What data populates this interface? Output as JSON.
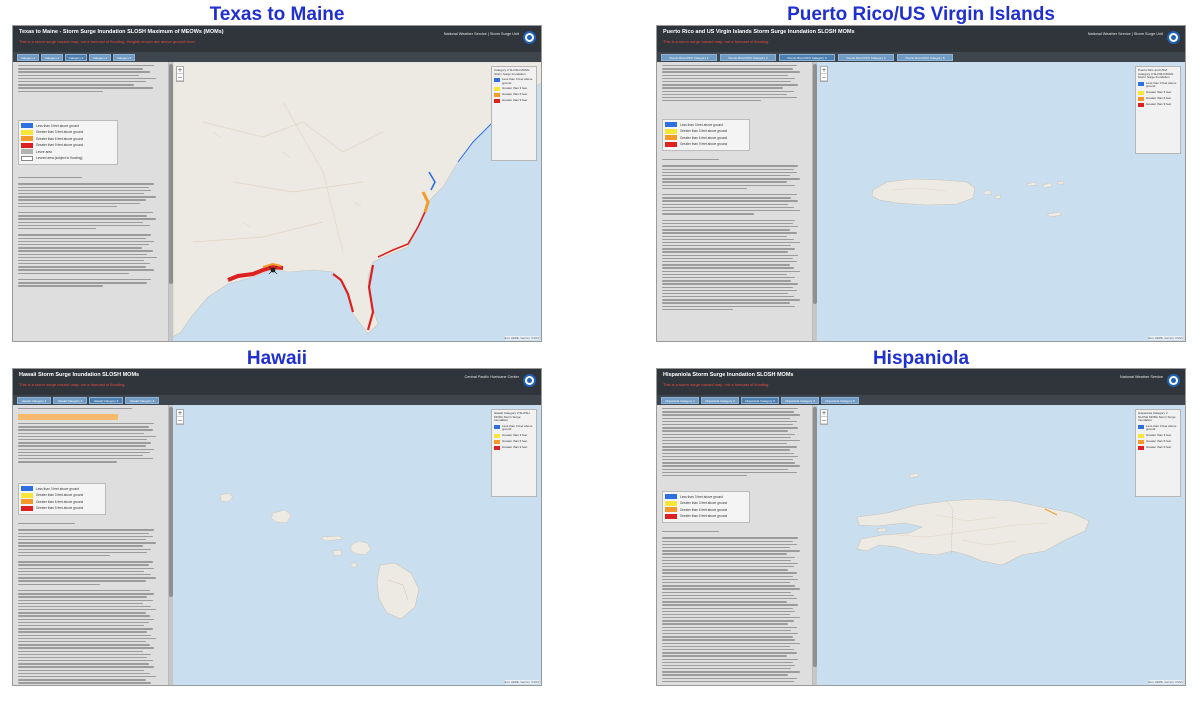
{
  "panels": [
    {
      "title": "Texas to Maine",
      "window_title": "Texas to Maine - Storm Surge Inundation SLOSH Maximum of MEOWs (MOMs)",
      "subtitle": "This is a storm surge hazard map; not a forecast of flooding. Heights shown are above ground level.",
      "org": "National Weather Service | Storm Surge Unit",
      "tabs": [
        "Category 1",
        "Category 2",
        "Category 3",
        "Category 4",
        "Category 5"
      ],
      "legend": [
        {
          "label": "Less than 3 feet above ground",
          "color": "#2f6fe0"
        },
        {
          "label": "Greater than 3 feet above ground",
          "color": "#f5e637"
        },
        {
          "label": "Greater than 6 feet above ground",
          "color": "#f39a2b"
        },
        {
          "label": "Greater than 9 feet above ground",
          "color": "#dd2020"
        },
        {
          "label": "Levee area",
          "color": "#b3b3b3"
        },
        {
          "label": "Leveed area (subject to flooding)",
          "color": "#ffffff"
        }
      ],
      "map_legend_title": "Category 3 SLOSH MOMs Storm Surge Inundation",
      "map_legend_items": [
        "Less than 3 feet above ground",
        "Greater than 3 feet",
        "Greater than 6 feet",
        "Greater than 9 feet"
      ],
      "attribution": "Esri, HERE, Garmin, USGS"
    },
    {
      "title": "Puerto Rico/US Virgin Islands",
      "window_title": "Puerto Rico and US Virgin Islands Storm Surge Inundation SLOSH MOMs",
      "subtitle": "This is a storm surge hazard map; not a forecast of flooding.",
      "org": "National Weather Service | Storm Surge Unit",
      "tabs": [
        "Puerto Rico/USVI Category 1",
        "Puerto Rico/USVI Category 2",
        "Puerto Rico/USVI Category 3",
        "Puerto Rico/USVI Category 4",
        "Puerto Rico/USVI Category 5"
      ],
      "legend": [
        {
          "label": "Less than 3 feet above ground",
          "color": "#2f6fe0"
        },
        {
          "label": "Greater than 3 feet above ground",
          "color": "#f5e637"
        },
        {
          "label": "Greater than 6 feet above ground",
          "color": "#f39a2b"
        },
        {
          "label": "Greater than 9 feet above ground",
          "color": "#dd2020"
        }
      ],
      "map_legend_title": "Puerto Rico and USVI Category 3 SLOSH MOMs Storm Surge Inundation",
      "map_legend_items": [
        "Less than 3 feet above ground",
        "Greater than 3 feet",
        "Greater than 6 feet",
        "Greater than 9 feet"
      ],
      "attribution": "Esri, HERE, Garmin, USGS"
    },
    {
      "title": "Hawaii",
      "window_title": "Hawaii Storm Surge Inundation SLOSH MOMs",
      "subtitle": "This is a storm surge hazard map; not a forecast of flooding.",
      "org": "Central Pacific Hurricane Center",
      "tabs": [
        "Hawaii Category 1",
        "Hawaii Category 2",
        "Hawaii Category 3",
        "Hawaii Category 4"
      ],
      "legend": [
        {
          "label": "Less than 3 feet above ground",
          "color": "#2f6fe0"
        },
        {
          "label": "Greater than 3 feet above ground",
          "color": "#f5e637"
        },
        {
          "label": "Greater than 6 feet above ground",
          "color": "#f39a2b"
        },
        {
          "label": "Greater than 9 feet above ground",
          "color": "#dd2020"
        }
      ],
      "map_legend_title": "Hawaii Category 3 SLOSH MOMs Storm Surge Inundation",
      "map_legend_items": [
        "Less than 3 feet above ground",
        "Greater than 3 feet",
        "Greater than 6 feet",
        "Greater than 9 feet"
      ],
      "attribution": "Esri, HERE, Garmin, USGS"
    },
    {
      "title": "Hispaniola",
      "window_title": "Hispaniola Storm Surge Inundation SLOSH MOMs",
      "subtitle": "This is a storm surge hazard map; not a forecast of flooding.",
      "org": "National Weather Service",
      "tabs": [
        "Hispaniola Category 1",
        "Hispaniola Category 2",
        "Hispaniola Category 3",
        "Hispaniola Category 4",
        "Hispaniola Category 5"
      ],
      "legend": [
        {
          "label": "Less than 3 feet above ground",
          "color": "#2f6fe0"
        },
        {
          "label": "Greater than 3 feet above ground",
          "color": "#f5e637"
        },
        {
          "label": "Greater than 6 feet above ground",
          "color": "#f39a2b"
        },
        {
          "label": "Greater than 9 feet above ground",
          "color": "#dd2020"
        }
      ],
      "map_legend_title": "Hispaniola Category 3 SLOSH MOMs Storm Surge Inundation",
      "map_legend_items": [
        "Less than 3 feet above ground",
        "Greater than 3 feet",
        "Greater than 6 feet",
        "Greater than 9 feet"
      ],
      "attribution": "Esri, HERE, Garmin, USGS"
    }
  ],
  "colors": {
    "title_blue": "#1f2fd0",
    "header_bar": "#2f353b",
    "ocean": "#c9dff0",
    "land": "#eceae3"
  }
}
